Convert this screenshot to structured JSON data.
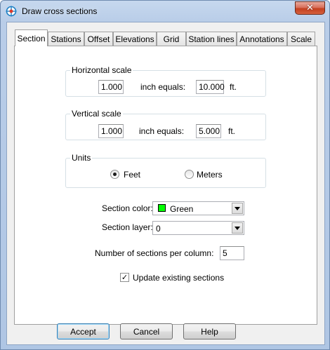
{
  "window": {
    "title": "Draw cross sections",
    "close_label": "✕"
  },
  "tabs": [
    "Section",
    "Stations",
    "Offset",
    "Elevations",
    "Grid",
    "Station lines",
    "Annotations",
    "Scale"
  ],
  "active_tab": "Section",
  "horizontal_scale": {
    "legend": "Horizontal scale",
    "inch_value": "1.000",
    "equals_label": "inch equals:",
    "feet_value": "10.000",
    "unit": "ft."
  },
  "vertical_scale": {
    "legend": "Vertical scale",
    "inch_value": "1.000",
    "equals_label": "inch equals:",
    "feet_value": "5.000",
    "unit": "ft."
  },
  "units": {
    "legend": "Units",
    "options": [
      "Feet",
      "Meters"
    ],
    "selected": "Feet"
  },
  "section_color": {
    "label": "Section color:",
    "value": "Green",
    "swatch": "#00ff00"
  },
  "section_layer": {
    "label": "Section layer:",
    "value": "0"
  },
  "sections_per_column": {
    "label": "Number of sections per column:",
    "value": "5"
  },
  "update_existing": {
    "label": "Update existing sections",
    "checked": true,
    "check_glyph": "✓"
  },
  "buttons": {
    "accept": "Accept",
    "cancel": "Cancel",
    "help": "Help"
  }
}
